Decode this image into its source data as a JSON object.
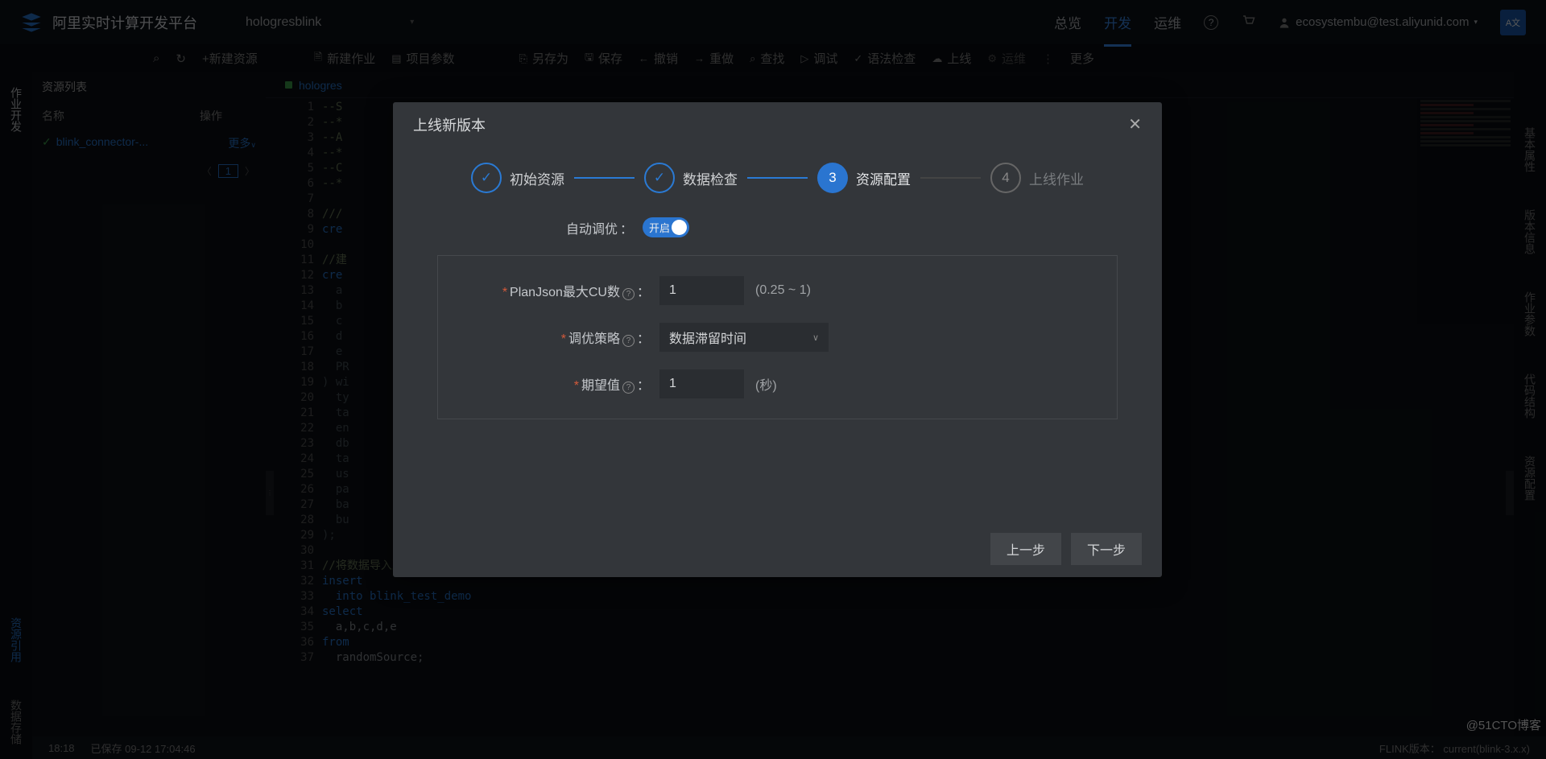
{
  "header": {
    "platform_name": "阿里实时计算开发平台",
    "project": "hologresblink",
    "nav": {
      "overview": "总览",
      "develop": "开发",
      "ops": "运维"
    },
    "user": "ecosystembu@test.aliyunid.com",
    "translate": "A文"
  },
  "toolbar": {
    "new_resource": "+新建资源",
    "new_job": "新建作业",
    "project_params": "项目参数",
    "save_as": "另存为",
    "save": "保存",
    "undo": "撤销",
    "redo": "重做",
    "find": "查找",
    "debug": "调试",
    "syntax": "语法检查",
    "publish": "上线",
    "run": "运维",
    "more": "更多"
  },
  "left_rail": {
    "job_dev": "作业开发",
    "res_ref": "资源引用",
    "data_store": "数据存储"
  },
  "sidebar": {
    "title": "资源列表",
    "col_name": "名称",
    "col_op": "操作",
    "file_name": "blink_connector-...",
    "more": "更多",
    "page": "1"
  },
  "editor": {
    "tab_name": "hologres",
    "lines": [
      "--S",
      "--*",
      "--A",
      "--*",
      "--C",
      "--*",
      "",
      "///",
      "cre",
      "",
      "//建",
      "cre",
      "  a",
      "  b",
      "  c",
      "  d",
      "  e",
      "  PR",
      ") wi",
      "  ty",
      "  ta",
      "  en",
      "  db",
      "  ta",
      "  us",
      "  pa",
      "  ba",
      "  bu",
      ");",
      "",
      "//将数据导入至连接表中",
      "insert",
      "  into blink_test_demo",
      "select",
      "  a,b,c,d,e",
      "from",
      "  randomSource;"
    ]
  },
  "right_rail": {
    "basic": "基本属性",
    "version": "版本信息",
    "params": "作业参数",
    "code": "代码结构",
    "res": "资源配置"
  },
  "modal": {
    "title": "上线新版本",
    "steps": [
      "初始资源",
      "数据检查",
      "资源配置",
      "上线作业"
    ],
    "auto_tune_label": "自动调优",
    "toggle_on": "开启",
    "plan_json_label": "PlanJson最大CU数",
    "plan_json_value": "1",
    "plan_json_hint": "(0.25 ~ 1)",
    "strategy_label": "调优策略",
    "strategy_value": "数据滞留时间",
    "expect_label": "期望值",
    "expect_value": "1",
    "expect_hint": "(秒)",
    "prev": "上一步",
    "next": "下一步"
  },
  "statusbar": {
    "cursor": "18:18",
    "saved": "已保存 09-12 17:04:46",
    "engine": "FLINK版本：  current(blink-3.x.x)"
  },
  "watermark": "@51CTO博客"
}
